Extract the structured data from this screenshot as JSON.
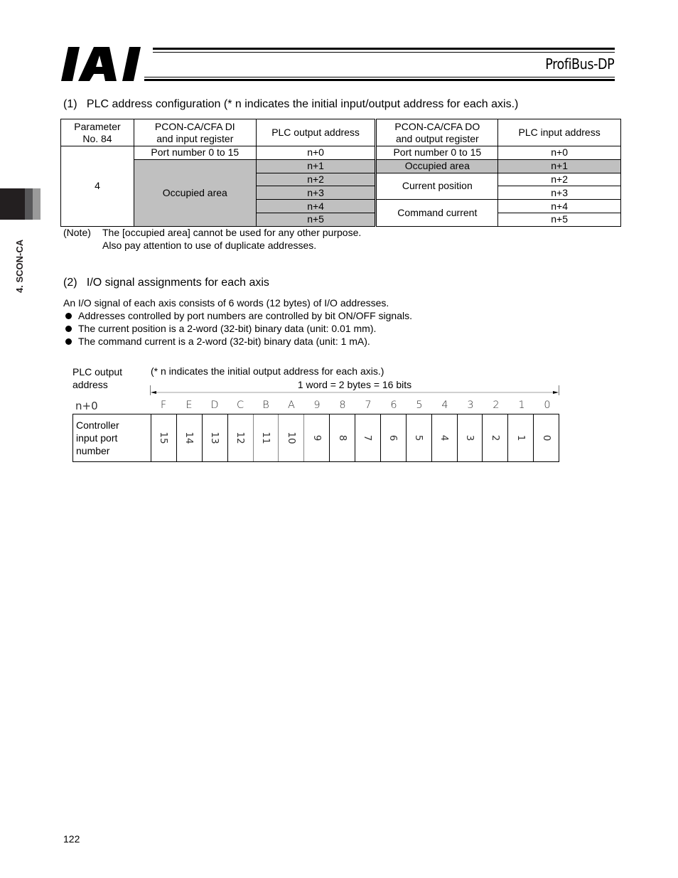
{
  "header": {
    "logo_text": "IAI",
    "title": "ProfiBus-DP"
  },
  "side_tab": {
    "label": "4. SCON-CA"
  },
  "section1": {
    "heading": "(1)   PLC address configuration (* n indicates the initial input/output address for each axis.)",
    "table": {
      "headers": [
        [
          "Parameter",
          "No. 84"
        ],
        [
          "PCON-CA/CFA DI",
          "and input register"
        ],
        [
          "PLC output address"
        ],
        [
          "PCON-CA/CFA DO",
          "and output register"
        ],
        [
          "PLC input address"
        ]
      ],
      "parameter_value": "4",
      "di_rows": [
        {
          "label": "Port number 0 to 15",
          "span": 1,
          "occupied": false
        },
        {
          "label": "Occupied area",
          "span": 5,
          "occupied": true
        }
      ],
      "plc_output_addresses": [
        "n+0",
        "n+1",
        "n+2",
        "n+3",
        "n+4",
        "n+5"
      ],
      "do_rows": [
        {
          "label": "Port number 0 to 15",
          "span": 1,
          "occupied": false
        },
        {
          "label": "Occupied area",
          "span": 1,
          "occupied": true
        },
        {
          "label": "Current position",
          "span": 2,
          "occupied": false
        },
        {
          "label": "Command current",
          "span": 2,
          "occupied": false
        }
      ],
      "plc_input_addresses": [
        "n+0",
        "n+1",
        "n+2",
        "n+3",
        "n+4",
        "n+5"
      ]
    },
    "note": {
      "tag": "(Note)",
      "line1": "The [occupied area] cannot be used for any other purpose.",
      "line2": "Also pay attention to use of duplicate addresses."
    }
  },
  "section2": {
    "heading": "(2)   I/O signal assignments for each axis",
    "intro": "An I/O signal of each axis consists of 6 words (12 bytes) of I/O addresses.",
    "bullets": [
      "Addresses controlled by port numbers are controlled by bit ON/OFF signals.",
      "The current position is a 2-word (32-bit) binary data (unit: 0.01 mm).",
      "The command current is a 2-word (32-bit) binary data (unit: 1 mA)."
    ],
    "diagram": {
      "plc_label_line1": "PLC output",
      "plc_label_line2": "address",
      "note": "(* n indicates the initial output address for each axis.)",
      "word_label": "1 word = 2 bytes = 16 bits",
      "address": "n+0",
      "bits": [
        "F",
        "E",
        "D",
        "C",
        "B",
        "A",
        "9",
        "8",
        "7",
        "6",
        "5",
        "4",
        "3",
        "2",
        "1",
        "0"
      ],
      "row_label_line1": "Controller",
      "row_label_line2": "input port",
      "row_label_line3": "number",
      "ports": [
        "15",
        "14",
        "13",
        "12",
        "11",
        "10",
        "9",
        "8",
        "7",
        "6",
        "5",
        "4",
        "3",
        "2",
        "1",
        "0"
      ]
    }
  },
  "page_number": "122",
  "colors": {
    "occupied_fill": "#c0c0c0",
    "tab_dark": "#231f20",
    "tab_mid": "#58585a",
    "tab_light": "#9a9a9a"
  }
}
